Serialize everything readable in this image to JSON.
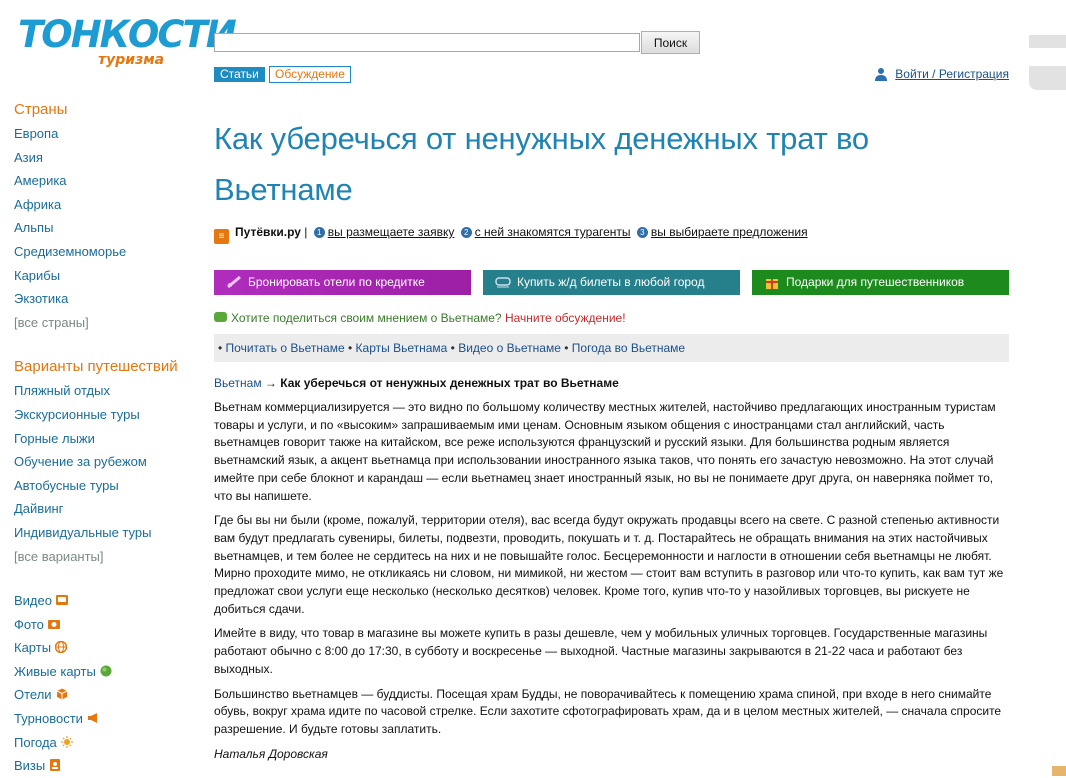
{
  "logo": {
    "line1": "ТОНКОСТИ",
    "line2": "туризма"
  },
  "search": {
    "button_label": "Поиск",
    "value": ""
  },
  "tabs": {
    "articles": "Статьи",
    "discussion": "Обсуждение"
  },
  "auth": {
    "login_label": "Войти / Регистрация"
  },
  "sidebar": {
    "countries_heading": "Страны",
    "countries": [
      "Европа",
      "Азия",
      "Америка",
      "Африка",
      "Альпы",
      "Средиземноморье",
      "Карибы",
      "Экзотика"
    ],
    "all_countries": "[все страны]",
    "variants_heading": "Варианты путешествий",
    "variants": [
      "Пляжный отдых",
      "Экскурсионные туры",
      "Горные лыжи",
      "Обучение за рубежом",
      "Автобусные туры",
      "Дайвинг",
      "Индивидуальные туры"
    ],
    "all_variants": "[все варианты]",
    "media": [
      {
        "label": "Видео",
        "icon": "video-icon",
        "color": "#e4770f"
      },
      {
        "label": "Фото",
        "icon": "camera-icon",
        "color": "#e4770f"
      },
      {
        "label": "Карты",
        "icon": "globe-icon",
        "color": "#e4770f"
      },
      {
        "label": "Живые карты",
        "icon": "earth-icon",
        "color": "#5aa83a"
      },
      {
        "label": "Отели",
        "icon": "box-icon",
        "color": "#e4770f"
      },
      {
        "label": "Турновости",
        "icon": "megaphone-icon",
        "color": "#e4770f"
      },
      {
        "label": "Погода",
        "icon": "sun-icon",
        "color": "#f0a020"
      },
      {
        "label": "Визы",
        "icon": "visa-icon",
        "color": "#e4770f"
      }
    ]
  },
  "article": {
    "title": "Как уберечься от ненужных денежных трат во Вьетнаме",
    "putevki": {
      "brand": "Путёвки.ру",
      "sep": "|",
      "steps": [
        "вы размещаете заявку",
        "с ней знакомятся турагенты",
        "вы выбираете предложения"
      ],
      "nums": [
        "1",
        "2",
        "3"
      ]
    },
    "banners": [
      "Бронировать отели по кредитке",
      "Купить ж/д билеты в любой город",
      "Подарки для путешественников"
    ],
    "opinion": {
      "text": "Хотите поделиться своим мнением о Вьетнаме?",
      "link": "Начните обсуждение!"
    },
    "links": [
      "Почитать о Вьетнаме",
      "Карты Вьетнама",
      "Видео о Вьетнаме",
      "Погода во Вьетнаме"
    ],
    "bullet": "•",
    "breadcrumb": {
      "root": "Вьетнам",
      "arrow": "→",
      "current": "Как уберечься от ненужных денежных трат во Вьетнаме"
    },
    "paragraphs": [
      "Вьетнам коммерциализируется — это видно по большому количеству местных жителей, настойчиво предлагающих иностранным туристам товары и услуги, и по «высоким» запрашиваемым ими ценам. Основным языком общения с иностранцами стал английский, часть вьетнамцев говорит также на китайском, все реже используются французский и русский языки. Для большинства родным является вьетнамский язык, а акцент вьетнамца при использовании иностранного языка таков, что понять его зачастую невозможно. На этот случай имейте при себе блокнот и карандаш — если вьетнамец знает иностранный язык, но вы не понимаете друг друга, он наверняка поймет то, что вы напишете.",
      "Где бы вы ни были (кроме, пожалуй, территории отеля), вас всегда будут окружать продавцы всего на свете. С разной степенью активности вам будут предлагать сувениры, билеты, подвезти, проводить, покушать и т. д. Постарайтесь не обращать внимания на этих настойчивых вьетнамцев, и тем более не сердитесь на них и не повышайте голос. Бесцеремонности и наглости в отношении себя вьетнамцы не любят. Мирно проходите мимо, не откликаясь ни словом, ни мимикой, ни жестом — стоит вам вступить в разговор или что-то купить, как вам тут же предложат свои услуги еще несколько (несколько десятков) человек. Кроме того, купив что-то у назойливых торговцев, вы рискуете не добиться сдачи.",
      "Имейте в виду, что товар в магазине вы можете купить в разы дешевле, чем у мобильных уличных торговцев. Государственные магазины работают обычно с 8:00 до 17:30, в субботу и воскресенье — выходной. Частные магазины закрываются в 21-22 часа и работают без выходных.",
      "Большинство вьетнамцев — буддисты. Посещая храм Будды, не поворачивайтесь к помещению храма спиной, при входе в него снимайте обувь, вокруг храма идите по часовой стрелке. Если захотите сфотографировать храм, да и в целом местных жителей, — сначала спросите разрешение. И будьте готовы заплатить."
    ],
    "author": "Наталья Доровская"
  }
}
